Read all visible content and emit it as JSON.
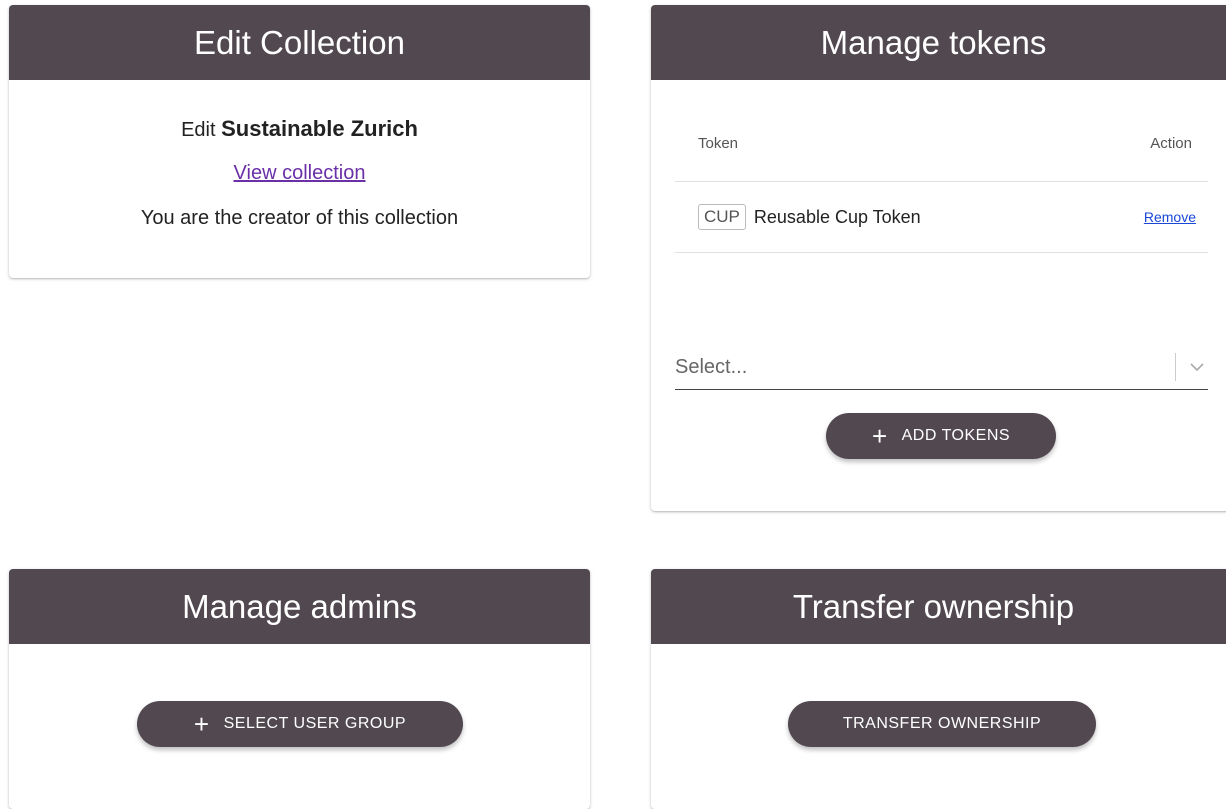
{
  "edit_collection": {
    "title": "Edit Collection",
    "edit_prefix": "Edit",
    "collection_name": "Sustainable Zurich",
    "view_link": "View collection",
    "creator_note": "You are the creator of this collection"
  },
  "manage_tokens": {
    "title": "Manage tokens",
    "columns": [
      "Token",
      "Action"
    ],
    "rows": [
      {
        "symbol": "CUP",
        "name": "Reusable Cup Token",
        "action": "Remove"
      }
    ],
    "select_placeholder": "Select...",
    "add_button": "ADD TOKENS"
  },
  "manage_admins": {
    "title": "Manage admins",
    "button": "SELECT USER GROUP"
  },
  "transfer_ownership": {
    "title": "Transfer ownership",
    "button": "TRANSFER OWNERSHIP"
  },
  "colors": {
    "header_bg": "#524950",
    "link_purple": "#6b2fa8",
    "link_blue": "#1a47d6"
  },
  "icons": {
    "plus": "plus-icon",
    "dropdown": "chevron-down-icon"
  }
}
